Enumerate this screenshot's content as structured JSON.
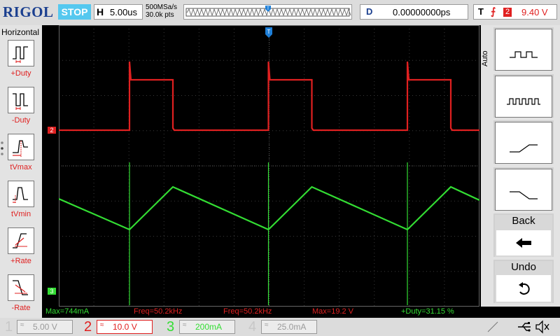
{
  "header": {
    "logo": "RIGOL",
    "run_state": "STOP",
    "timebase_key": "H",
    "timebase_value": "5.00us",
    "sample_rate": "500MSa/s",
    "memory_depth": "30.0k pts",
    "delay_key": "D",
    "delay_value": "0.00000000ps",
    "trigger_key": "T",
    "trigger_source": "2",
    "trigger_level": "9.40 V"
  },
  "left_menu": {
    "title": "Horizontal",
    "items": [
      {
        "label": "+Duty",
        "icon": "positive-duty-icon"
      },
      {
        "label": "-Duty",
        "icon": "negative-duty-icon"
      },
      {
        "label": "tVmax",
        "icon": "time-at-vmax-icon"
      },
      {
        "label": "tVmin",
        "icon": "time-at-vmin-icon"
      },
      {
        "label": "+Rate",
        "icon": "rise-rate-icon"
      },
      {
        "label": "-Rate",
        "icon": "fall-rate-icon"
      }
    ]
  },
  "right_menu": {
    "mode_label": "Auto",
    "items": [
      {
        "label": "",
        "icon": "single-pulse-train-icon"
      },
      {
        "label": "",
        "icon": "dense-pulse-train-icon"
      },
      {
        "label": "",
        "icon": "rising-slope-icon"
      },
      {
        "label": "",
        "icon": "falling-slope-icon"
      },
      {
        "label": "Back",
        "icon": "back-arrow-icon"
      },
      {
        "label": "Undo",
        "icon": "undo-icon"
      }
    ]
  },
  "channel_markers": {
    "ch2": "2",
    "ch3": "3"
  },
  "measurements": [
    {
      "text": "Max=744mA",
      "color": "#33dd33"
    },
    {
      "text": "Freq=50.2kHz",
      "color": "#33dd33"
    },
    {
      "text": "Freq=50.2kHz",
      "color": "#e02020"
    },
    {
      "text": "Max=19.2 V",
      "color": "#e02020"
    },
    {
      "text": "+Duty=31.15 %",
      "color": "#e02020"
    }
  ],
  "channels": [
    {
      "number": "1",
      "coupling": "≈",
      "scale": "5.00 V",
      "color": "#c8c8c8",
      "active": false
    },
    {
      "number": "2",
      "coupling": "≈",
      "scale": "10.0 V",
      "color": "#e02020",
      "active": true
    },
    {
      "number": "3",
      "coupling": "≈",
      "scale": "200mA",
      "color": "#33dd33",
      "active": false
    },
    {
      "number": "4",
      "coupling": "≈",
      "scale": "25.0mA",
      "color": "#c8c8c8",
      "active": false
    }
  ],
  "colors": {
    "ch2_trace": "#e02020",
    "ch3_trace": "#33dd33",
    "grid": "#3a3a3a",
    "trigger_marker": "#1e7fd8"
  }
}
